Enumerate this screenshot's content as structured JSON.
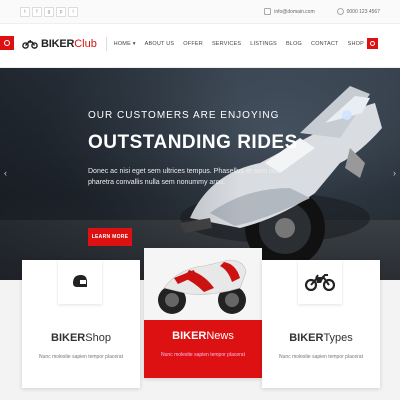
{
  "topbar": {
    "social_icons": [
      "twitter-icon",
      "facebook-icon",
      "google-plus-icon",
      "pinterest-icon",
      "instagram-icon"
    ],
    "social_glyphs": [
      "t",
      "f",
      "g",
      "p",
      "i"
    ],
    "email": "info@domain.com",
    "phone": "0000 123 4567"
  },
  "header": {
    "logo_main": "BIKER",
    "logo_accent": "Club",
    "nav": [
      "HOME",
      "ABOUT US",
      "OFFER",
      "SERVICES",
      "LISTINGS",
      "BLOG",
      "CONTACT",
      "SHOP"
    ],
    "home_chevron": "▾"
  },
  "hero": {
    "subtitle": "OUR CUSTOMERS ARE ENJOYING",
    "title": "OUTSTANDING RIDES",
    "text": "Donec ac nisi eget sem ultrices tempus. Phasellus et sem non pharetra convallis nulla sem nonummy arcu.",
    "button": "LEARN MORE",
    "prev": "‹",
    "next": "›"
  },
  "cards": [
    {
      "title_bold": "BIKER",
      "title_rest": "Shop",
      "text": "Nunc molestie sapien tempor placerat",
      "icon": "helmet-icon"
    },
    {
      "title_bold": "BIKER",
      "title_rest": "News",
      "text": "Nunc molestie sapien tempor placerat",
      "icon": "motorcycle-photo"
    },
    {
      "title_bold": "BIKER",
      "title_rest": "Types",
      "text": "Nunc molestie sapien tempor placerat",
      "icon": "motorcycle-icon"
    }
  ],
  "colors": {
    "accent": "#dd1111",
    "dark": "#222222"
  }
}
